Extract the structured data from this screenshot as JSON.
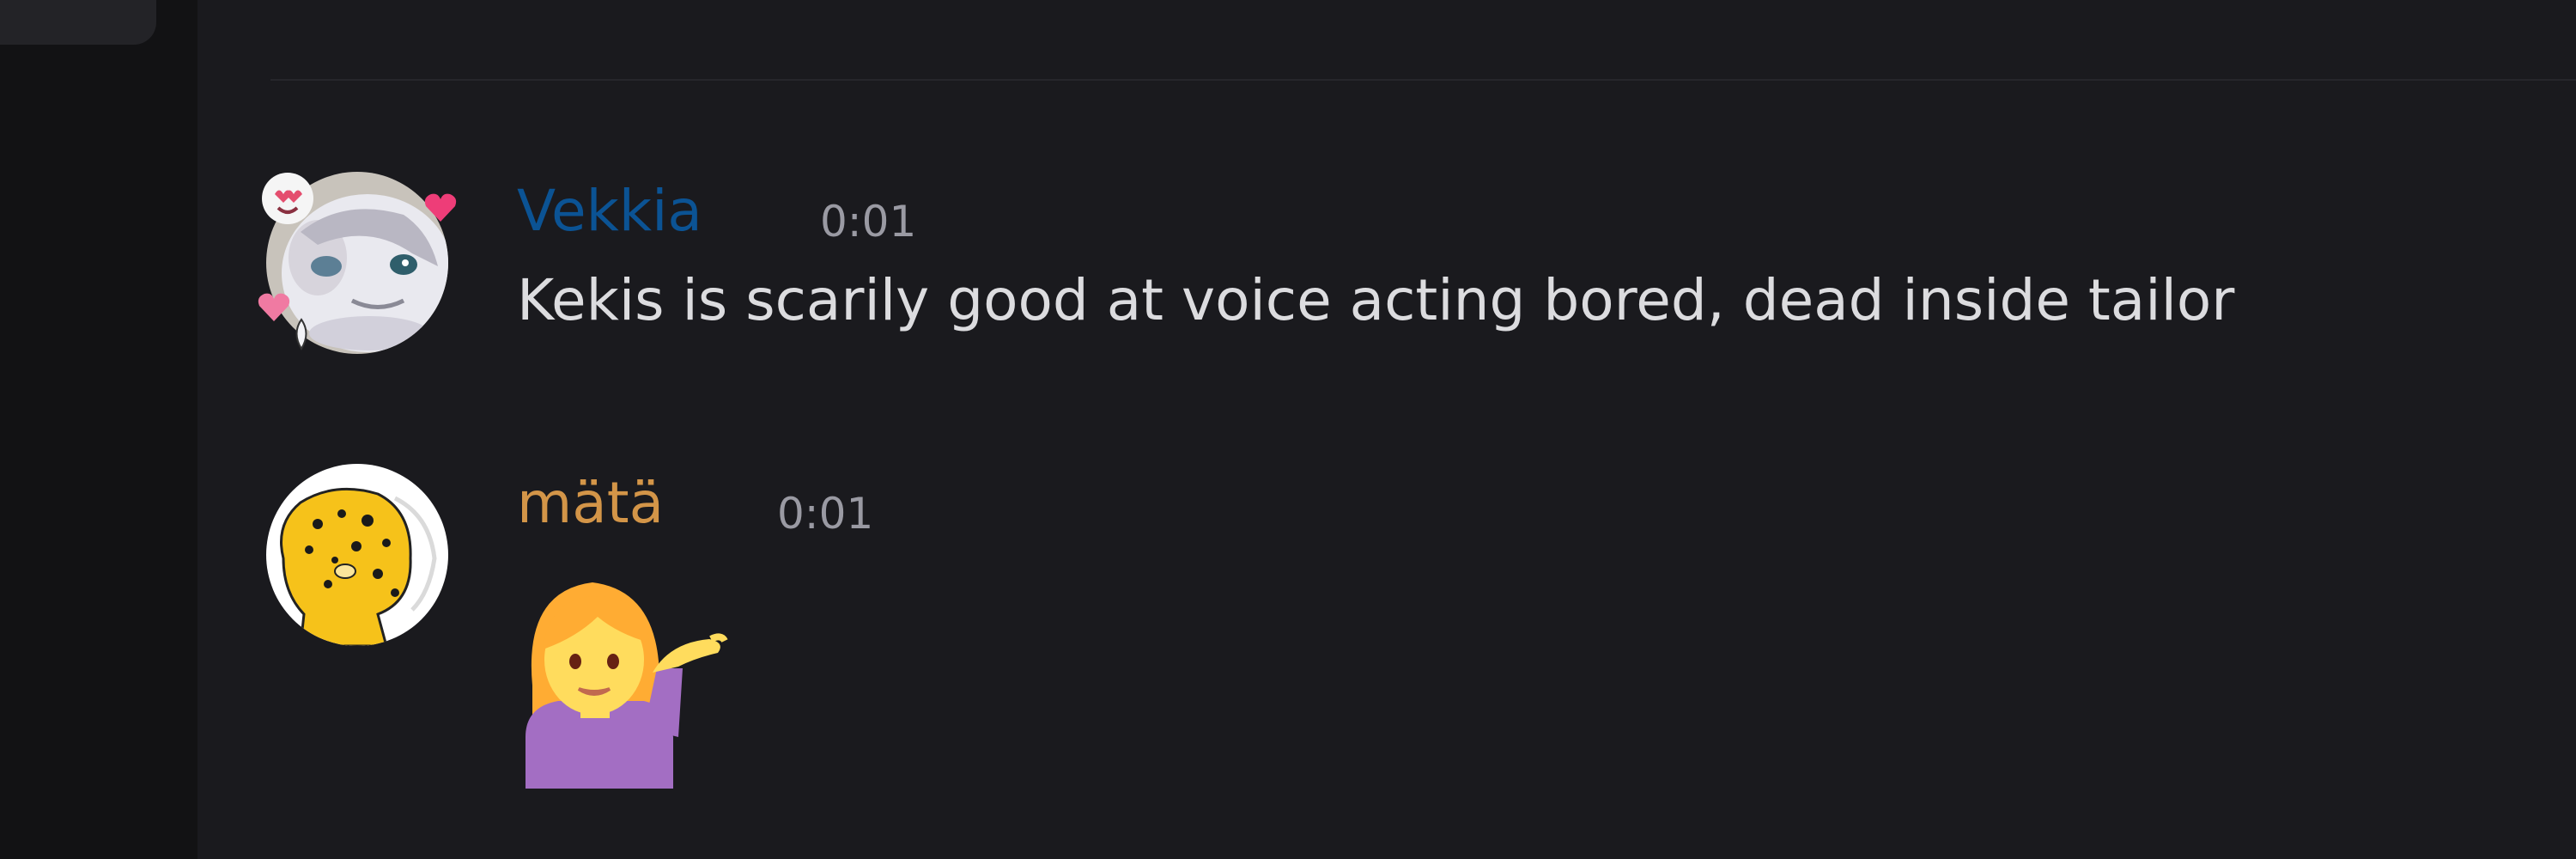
{
  "messages": [
    {
      "author": "Vekkia",
      "author_color": "#0b5394",
      "timestamp": "0:01",
      "text": "Kekis is scarily good at voice acting bored, dead inside tailor",
      "avatar_icon": "decorated-white-creature-avatar-icon"
    },
    {
      "author": "mätä",
      "author_color": "#d39548",
      "timestamp": "0:01",
      "emoji": "person-tipping-hand-icon",
      "avatar_icon": "yellow-spotted-creature-avatar-icon"
    }
  ],
  "colors": {
    "background": "#1a1a1e",
    "left_rail": "#121214",
    "timestamp": "#9a9aa3",
    "message_text": "#dcdcdf"
  }
}
